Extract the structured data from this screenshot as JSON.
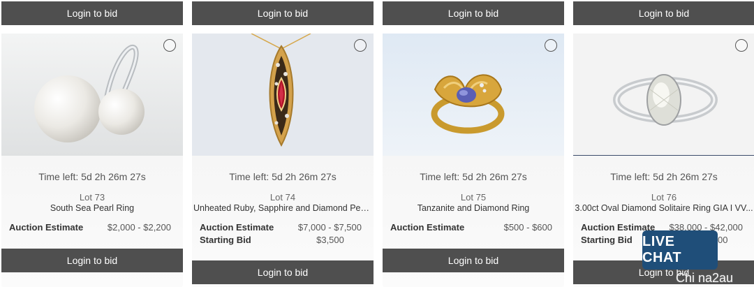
{
  "lots": [
    {
      "top_button": "Login to bid",
      "time_left": "Time left: 5d 2h 26m 27s",
      "lot_number": "Lot 73",
      "title": "South Sea Pearl Ring",
      "estimate_label": "Auction Estimate",
      "estimate_value": "$2,000 - $2,200",
      "bid_button": "Login to bid"
    },
    {
      "top_button": "Login to bid",
      "time_left": "Time left: 5d 2h 26m 27s",
      "lot_number": "Lot 74",
      "title": "Unheated Ruby, Sapphire and Diamond Pen...",
      "estimate_label": "Auction Estimate",
      "estimate_value": "$7,000 - $7,500",
      "starting_label": "Starting Bid",
      "starting_value": "$3,500",
      "bid_button": "Login to bid"
    },
    {
      "top_button": "Login to bid",
      "time_left": "Time left: 5d 2h 26m 27s",
      "lot_number": "Lot 75",
      "title": "Tanzanite and Diamond Ring",
      "estimate_label": "Auction Estimate",
      "estimate_value": "$500 - $600",
      "bid_button": "Login to bid"
    },
    {
      "top_button": "Login to bid",
      "time_left": "Time left: 5d 2h 26m 27s",
      "lot_number": "Lot 76",
      "title": "3.00ct Oval Diamond Solitaire Ring GIA I VV...",
      "estimate_label": "Auction Estimate",
      "estimate_value": "$38,000 - $42,000",
      "starting_label": "Starting Bid",
      "starting_value": "$20,000",
      "bid_button": "Login to bid"
    }
  ],
  "live_chat": {
    "label": "LIVE CHAT"
  },
  "watermark": {
    "text": "Chi na2au"
  }
}
